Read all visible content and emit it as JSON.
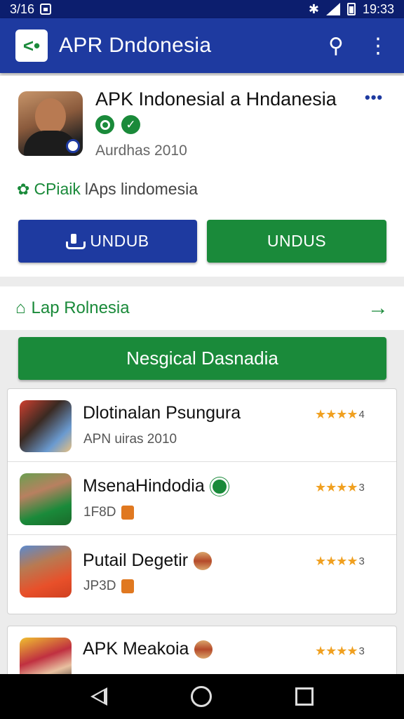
{
  "status_bar": {
    "time_left": "3/16",
    "time_right": "19:33"
  },
  "app_bar": {
    "title": "APR Dndonesia",
    "logo_icon": "back-logo-icon",
    "search_icon": "search-icon",
    "menu_icon": "more-vert-icon"
  },
  "app_card": {
    "name": "APK Indonesial a Hndanesia",
    "subtitle": "Aurdhas 2010",
    "category_prefix": "CPiaik",
    "category_text": "lAps lindomesia",
    "more": "•••",
    "buttons": {
      "primary_label": "UNDUB",
      "secondary_label": "UNDUS"
    }
  },
  "section": {
    "title": "Lap Rolnesia",
    "banner": "Nesgical Dasnadia"
  },
  "list": [
    {
      "title": "Dlotinalan Psungura",
      "sub": "APN uiras 2010",
      "rating_num": "4",
      "stars": 3.5
    },
    {
      "title": "MsenaHindodia",
      "sub": "1F8D",
      "rating_num": "3",
      "stars": 3.5
    },
    {
      "title": "Putail Degetir",
      "sub": "JP3D",
      "rating_num": "3",
      "stars": 3.5
    },
    {
      "title": "APK Meakoia",
      "sub": "",
      "rating_num": "3",
      "stars": 3.5
    }
  ],
  "colors": {
    "primary": "#1e3aa0",
    "accent": "#1a8a3a",
    "star": "#f0a020"
  }
}
